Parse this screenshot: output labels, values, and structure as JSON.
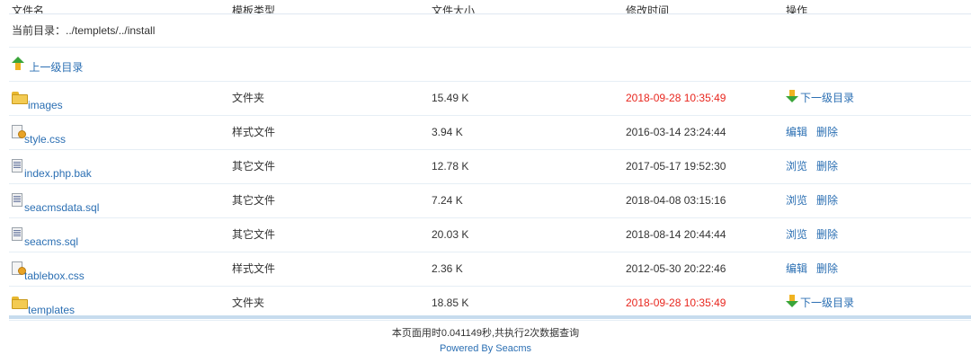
{
  "header": {
    "col_name": "文件名",
    "col_type": "模板类型",
    "col_size": "文件大小",
    "col_time": "修改时间",
    "col_action": "操作"
  },
  "current_dir": "当前目录：../templets/../install",
  "parent_link": "上一级目录",
  "rows": [
    {
      "icon": "folder-icon",
      "name": "images",
      "type": "文件夹",
      "size": "15.49 K",
      "time": "2018-09-28 10:35:49",
      "time_highlight": true,
      "actions": [
        "下一级目录"
      ]
    },
    {
      "icon": "css-file-icon",
      "name": "style.css",
      "type": "样式文件",
      "size": "3.94 K",
      "time": "2016-03-14 23:24:44",
      "time_highlight": false,
      "actions": [
        "编辑",
        "删除"
      ]
    },
    {
      "icon": "text-file-icon",
      "name": "index.php.bak",
      "type": "其它文件",
      "size": "12.78 K",
      "time": "2017-05-17 19:52:30",
      "time_highlight": false,
      "actions": [
        "浏览",
        "删除"
      ]
    },
    {
      "icon": "text-file-icon",
      "name": "seacmsdata.sql",
      "type": "其它文件",
      "size": "7.24 K",
      "time": "2018-04-08 03:15:16",
      "time_highlight": false,
      "actions": [
        "浏览",
        "删除"
      ]
    },
    {
      "icon": "text-file-icon",
      "name": "seacms.sql",
      "type": "其它文件",
      "size": "20.03 K",
      "time": "2018-08-14 20:44:44",
      "time_highlight": false,
      "actions": [
        "浏览",
        "删除"
      ]
    },
    {
      "icon": "css-file-icon",
      "name": "tablebox.css",
      "type": "样式文件",
      "size": "2.36 K",
      "time": "2012-05-30 20:22:46",
      "time_highlight": false,
      "actions": [
        "编辑",
        "删除"
      ]
    },
    {
      "icon": "folder-icon",
      "name": "templates",
      "type": "文件夹",
      "size": "18.85 K",
      "time": "2018-09-28 10:35:49",
      "time_highlight": true,
      "actions": [
        "下一级目录"
      ]
    }
  ],
  "footer": {
    "stats": "本页面用时0.041149秒,共执行2次数据查询",
    "powered": "Powered By Seacms"
  },
  "colors": {
    "link": "#2b6fb3",
    "highlight": "#e8261e",
    "divider": "#c7dcee"
  }
}
